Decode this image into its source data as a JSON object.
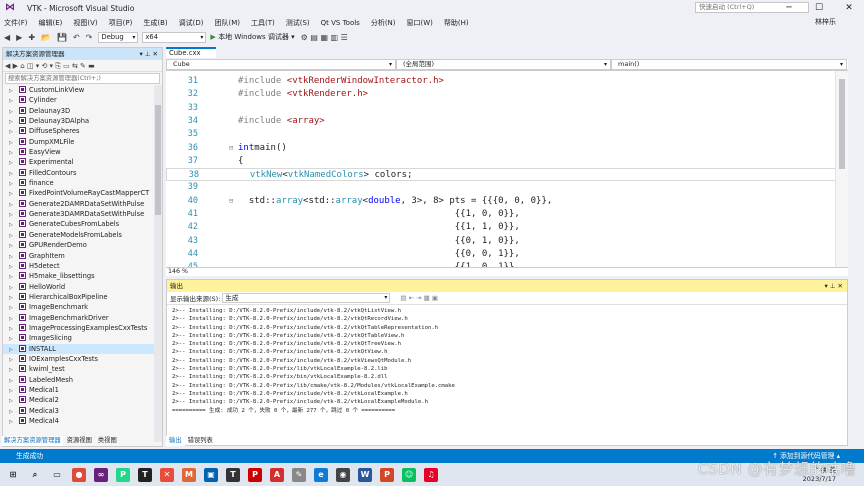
{
  "app": {
    "title": "VTK - Microsoft Visual Studio",
    "logo_icon": "vs-logo-icon"
  },
  "menu": [
    "文件(F)",
    "编辑(E)",
    "视图(V)",
    "项目(P)",
    "生成(B)",
    "调试(D)",
    "团队(M)",
    "工具(T)",
    "测试(S)",
    "Qt VS Tools",
    "分析(N)",
    "窗口(W)",
    "帮助(H)"
  ],
  "quick_launch": {
    "placeholder": "快速启动 (Ctrl+Q)",
    "notif": "1"
  },
  "user": "林梓乐",
  "toolbar": {
    "config": "Debug",
    "platform": "x64",
    "run_label": "本地 Windows 调试器"
  },
  "solution_explorer": {
    "title": "解决方案资源管理器",
    "search_placeholder": "搜索解决方案资源管理器(Ctrl+;)",
    "items": [
      "CustomLinkView",
      "Cylinder",
      "Delaunay3D",
      "Delaunay3DAlpha",
      "DiffuseSpheres",
      "DumpXMLFile",
      "EasyView",
      "Experimental",
      "FilledContours",
      "finance",
      "FixedPointVolumeRayCastMapperCT",
      "Generate2DAMRDataSetWithPulse",
      "Generate3DAMRDataSetWithPulse",
      "GenerateCubesFromLabels",
      "GenerateModelsFromLabels",
      "GPURenderDemo",
      "GraphItem",
      "H5detect",
      "H5make_libsettings",
      "HelloWorld",
      "HierarchicalBoxPipeline",
      "ImageBenchmark",
      "ImageBenchmarkDriver",
      "ImageProcessingExamplesCxxTests",
      "ImageSlicing",
      "INSTALL",
      "IOExamplesCxxTests",
      "kwiml_test",
      "LabeledMesh",
      "Medical1",
      "Medical2",
      "Medical3",
      "Medical4"
    ],
    "selected": "INSTALL",
    "tabs": [
      "解决方案资源管理器",
      "资源视图",
      "类视图"
    ]
  },
  "editor": {
    "tab": "Cube.cxx",
    "nav": {
      "project": "Cube",
      "scope": "(全局范围)",
      "member": "main()"
    },
    "zoom": "146 %",
    "lines": [
      {
        "n": "31",
        "parts": [
          [
            "pp",
            "#include "
          ],
          [
            "str",
            "<vtkRenderWindowInteractor.h>"
          ]
        ]
      },
      {
        "n": "32",
        "parts": [
          [
            "pp",
            "#include "
          ],
          [
            "str",
            "<vtkRenderer.h>"
          ]
        ]
      },
      {
        "n": "33",
        "parts": []
      },
      {
        "n": "34",
        "parts": [
          [
            "pp",
            "#include "
          ],
          [
            "str",
            "<array>"
          ]
        ]
      },
      {
        "n": "35",
        "parts": []
      },
      {
        "n": "36",
        "parts": [
          [
            "kw",
            "int"
          ],
          [
            "",
            "main()"
          ]
        ]
      },
      {
        "n": "37",
        "parts": [
          [
            "",
            "{"
          ]
        ]
      },
      {
        "n": "38",
        "parts": [
          [
            "",
            "  "
          ],
          [
            "ty",
            "vtkNew"
          ],
          [
            "",
            "<"
          ],
          [
            "ty",
            "vtkNamedColors"
          ],
          [
            "",
            "> colors;"
          ]
        ]
      },
      {
        "n": "39",
        "parts": []
      },
      {
        "n": "40",
        "parts": [
          [
            "",
            "  std::"
          ],
          [
            "ty",
            "array"
          ],
          [
            "",
            "<std::"
          ],
          [
            "ty",
            "array"
          ],
          [
            "",
            "<"
          ],
          [
            "kw",
            "double"
          ],
          [
            "",
            ", 3>, 8> pts = {{{0, 0, 0}},"
          ]
        ]
      },
      {
        "n": "41",
        "parts": [
          [
            "",
            "                                        {{1, 0, 0}},"
          ]
        ]
      },
      {
        "n": "42",
        "parts": [
          [
            "",
            "                                        {{1, 1, 0}},"
          ]
        ]
      },
      {
        "n": "43",
        "parts": [
          [
            "",
            "                                        {{0, 1, 0}},"
          ]
        ]
      },
      {
        "n": "44",
        "parts": [
          [
            "",
            "                                        {{0, 0, 1}},"
          ]
        ]
      },
      {
        "n": "45",
        "parts": [
          [
            "",
            "                                        {{1, 0, 1}},"
          ]
        ]
      }
    ]
  },
  "output": {
    "title": "输出",
    "source_label": "显示输出来源(S):",
    "source": "生成",
    "lines": [
      "2>-- Installing: D:/VTK-8.2.0-Prefix/include/vtk-8.2/vtkQtListView.h",
      "2>-- Installing: D:/VTK-8.2.0-Prefix/include/vtk-8.2/vtkQtRecordView.h",
      "2>-- Installing: D:/VTK-8.2.0-Prefix/include/vtk-8.2/vtkQtTableRepresentation.h",
      "2>-- Installing: D:/VTK-8.2.0-Prefix/include/vtk-8.2/vtkQtTableView.h",
      "2>-- Installing: D:/VTK-8.2.0-Prefix/include/vtk-8.2/vtkQtTreeView.h",
      "2>-- Installing: D:/VTK-8.2.0-Prefix/include/vtk-8.2/vtkQtView.h",
      "2>-- Installing: D:/VTK-8.2.0-Prefix/include/vtk-8.2/vtkViewsQtModule.h",
      "2>-- Installing: D:/VTK-8.2.0-Prefix/lib/vtkLocalExample-8.2.lib",
      "2>-- Installing: D:/VTK-8.2.0-Prefix/bin/vtkLocalExample-8.2.dll",
      "2>-- Installing: D:/VTK-8.2.0-Prefix/lib/cmake/vtk-8.2/Modules/vtkLocalExample.cmake",
      "2>-- Installing: D:/VTK-8.2.0-Prefix/include/vtk-8.2/vtkLocalExample.h",
      "2>-- Installing: D:/VTK-8.2.0-Prefix/include/vtk-8.2/vtkLocalExampleModule.h",
      "========== 生成: 成功 2 个，失败 0 个，最新 277 个，跳过 0 个 =========="
    ],
    "tabs": [
      "输出",
      "错误列表"
    ]
  },
  "status": {
    "left": "生成成功",
    "right": "↑ 添加到源代码管理 ▴"
  },
  "taskbar": {
    "icons": [
      "windows-start-icon",
      "search-icon",
      "taskview-icon",
      "chrome-icon",
      "visual-studio-icon",
      "pycharm-icon",
      "typora-icon",
      "xmind-icon",
      "matlab-icon",
      "photos-icon",
      "typora-t-icon",
      "pdf-icon",
      "acrobat-icon",
      "tool-icon",
      "edge-icon",
      "camera-icon",
      "word-icon",
      "powerpoint-icon",
      "wechat-icon",
      "netease-music-icon"
    ],
    "clock": "2023/7/17",
    "tray": "^ 拼 英"
  },
  "watermark": "CSDN @有梦想的咕噜"
}
